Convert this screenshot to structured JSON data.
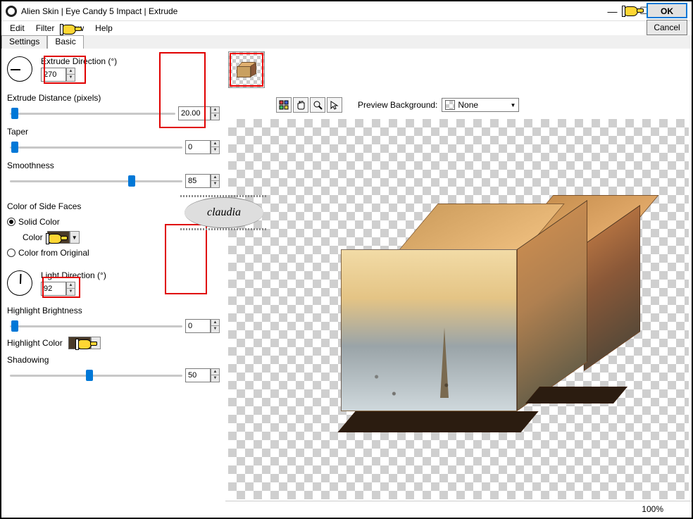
{
  "window": {
    "title": "Alien Skin | Eye Candy 5 Impact | Extrude"
  },
  "titlebar_buttons": {
    "minimize": "—",
    "maximize": "☐",
    "close": "✕"
  },
  "menu": {
    "edit": "Edit",
    "filter": "Filter",
    "view": "View",
    "help": "Help"
  },
  "tabs": {
    "settings": "Settings",
    "basic": "Basic"
  },
  "params": {
    "extrude_direction_label": "Extrude Direction (°)",
    "extrude_direction_value": "270",
    "extrude_distance_label": "Extrude Distance (pixels)",
    "extrude_distance_value": "20.00",
    "taper_label": "Taper",
    "taper_value": "0",
    "smoothness_label": "Smoothness",
    "smoothness_value": "85",
    "side_face_group": "Color of Side Faces",
    "solid_color_label": "Solid Color",
    "color_label": "Color",
    "color_from_original_label": "Color from Original",
    "light_direction_label": "Light Direction (°)",
    "light_direction_value": "92",
    "highlight_brightness_label": "Highlight Brightness",
    "highlight_brightness_value": "0",
    "highlight_color_label": "Highlight Color",
    "shadowing_label": "Shadowing",
    "shadowing_value": "50"
  },
  "toolbar": {
    "preview_bg_label": "Preview Background:",
    "preview_bg_value": "None"
  },
  "buttons": {
    "ok": "OK",
    "cancel": "Cancel"
  },
  "status": {
    "zoom": "100%"
  },
  "watermark": "claudia",
  "spin_up": "▲",
  "spin_down": "▼",
  "dropdown_arrow": "▼"
}
